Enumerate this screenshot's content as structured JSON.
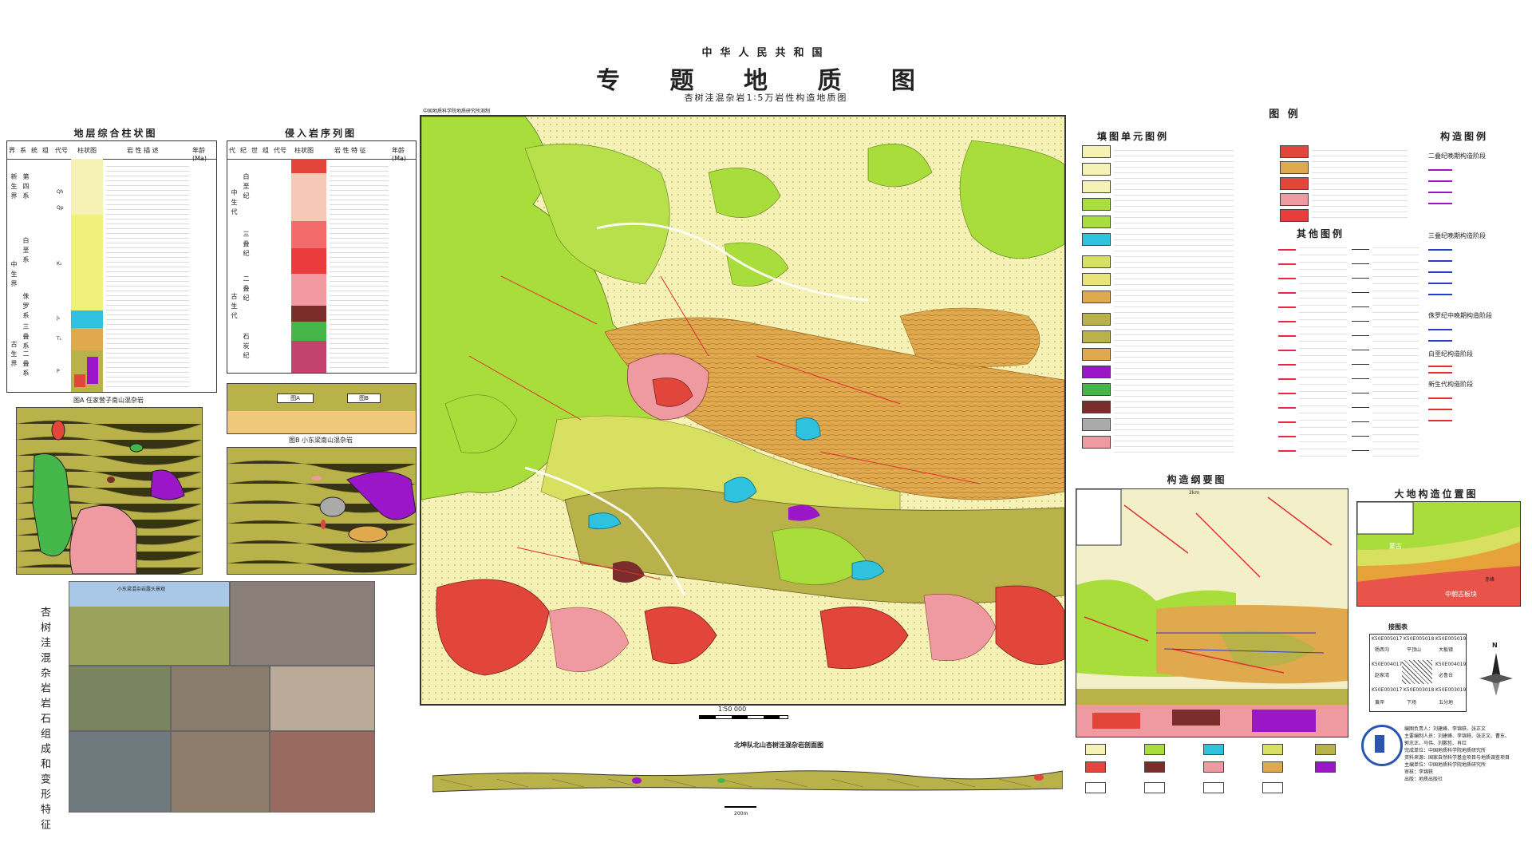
{
  "header": {
    "country": "中华人民共和国",
    "title": "专 题 地 质 图",
    "subtitle": "杏树洼混杂岩1∶5万岩性构造地质图"
  },
  "strat_column": {
    "title": "地层综合柱状图",
    "headers": [
      "界",
      "系",
      "统",
      "组",
      "代号",
      "柱状图",
      "岩 性 描 述",
      "年龄 (Ma)"
    ],
    "eras": [
      "新生界",
      "中生界",
      "古生界"
    ],
    "systems": [
      "第四系",
      "白垩系",
      "侏罗系",
      "三叠系",
      "二叠系"
    ],
    "codes": [
      "Qh",
      "Qp",
      "K₁",
      "J₁",
      "T₁",
      "P"
    ]
  },
  "intrusive_column": {
    "title": "侵入岩序列图",
    "headers": [
      "代",
      "纪",
      "世",
      "组",
      "代号",
      "柱状图",
      "岩 性 特 征",
      "年龄 (Ma)"
    ],
    "periods": [
      "白垩纪",
      "三叠纪",
      "二叠纪",
      "石炭纪"
    ],
    "eras": [
      "中生代",
      "古生代"
    ]
  },
  "figures": {
    "fig_a": "图A 任家营子南山混杂岩",
    "fig_b": "图B 小东梁南山混杂岩",
    "fig_a_label": "图A",
    "fig_b_label": "图B",
    "photo_caption": "杏树洼混杂岩岩石组成和变形特征",
    "photo_top": "小东梁混杂岩露头景观"
  },
  "main_map": {
    "header_left": "中国地质科学院地质研究所测制",
    "scale": "1∶50 000"
  },
  "section": {
    "title": "北坤队北山杏树洼混杂岩剖面图",
    "scale": "200m"
  },
  "legend": {
    "title": "图 例",
    "unit_title": "填图单元图例",
    "structure_title": "构造图例",
    "other_title": "其他图例",
    "structure_stages": [
      "二叠纪晚期构造阶段",
      "三叠纪晚期构造阶段",
      "侏罗纪中晚期构造阶段",
      "白垩纪构造阶段",
      "新生代构造阶段"
    ]
  },
  "tectonic_outline": {
    "title": "构造纲要图",
    "scale": "2km"
  },
  "tectonic_position": {
    "title": "大地构造位置图",
    "labels": [
      "蒙古",
      "中朝古板块",
      "赤峰"
    ]
  },
  "index_table": {
    "title": "接图表",
    "cells": [
      "K50E005017",
      "K50E005018",
      "K50E005019",
      "杨西沟",
      "平顶山",
      "大板镇",
      "K50E004017",
      "",
      "K50E004019",
      "赵家湾",
      "",
      "必鲁台",
      "K50E003017",
      "K50E003018",
      "K50E003019",
      "黄岸",
      "下场",
      "五分地"
    ]
  },
  "credits": {
    "north": "N",
    "lines": [
      "编图负责人：刘建峰、李锦轶、张正文",
      "主要编制人员：刘建峰、李锦轶、张正文、曹东、",
      "郭忠正、马伟、刘鹏哲、肖红",
      "完成单位：中国地质科学院地质研究所",
      "资料来源：国家自然科学基金项目与地质调查项目",
      "主编单位：中国地质科学院地质研究所",
      "审核：李锦轶",
      "出版：地质出版社"
    ]
  },
  "colors": {
    "quaternary": "#f6f1b4",
    "cretaceous": "#a9dd3c",
    "jurassic_light": "#d7e060",
    "permian_olive": "#b9b14a",
    "triassic_orange": "#e0a94e",
    "granite_red": "#e2453a",
    "pink": "#ef9aa0",
    "cyan": "#2fc2df",
    "brown": "#7a2d2a",
    "purple": "#9a16c8",
    "green_block": "#44b64a"
  }
}
